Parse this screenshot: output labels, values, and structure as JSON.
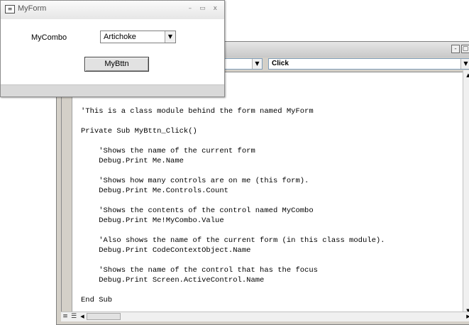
{
  "form": {
    "title": "MyForm",
    "icon": "form-icon",
    "controls": {
      "minimize": "–",
      "maximize": "▭",
      "close": "x"
    },
    "combo_label": "MyCombo",
    "combo_value": "Artichoke",
    "button_label": "MyBttn"
  },
  "code_window": {
    "window_buttons": {
      "minimize": "-",
      "maximize": "▢",
      "close": "×"
    },
    "object_combo_value": "",
    "procedure_combo_value": "Click",
    "code": "'This is a class module behind the form named MyForm\n\nPrivate Sub MyBttn_Click()\n\n    'Shows the name of the current form\n    Debug.Print Me.Name\n\n    'Shows how many controls are on me (this form).\n    Debug.Print Me.Controls.Count\n\n    'Shows the contents of the control named MyCombo\n    Debug.Print Me!MyCombo.Value\n\n    'Also shows the name of the current form (in this class module).\n    Debug.Print CodeContextObject.Name\n\n    'Shows the name of the control that has the focus\n    Debug.Print Screen.ActiveControl.Name\n\nEnd Sub"
  }
}
